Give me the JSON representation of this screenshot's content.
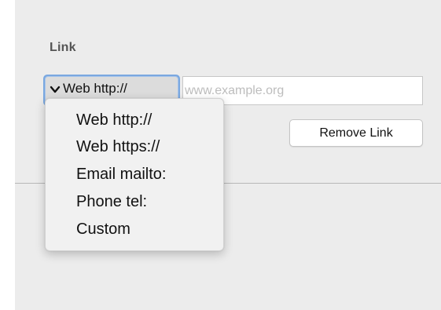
{
  "link_section": {
    "title": "Link",
    "protocol_selector": {
      "selected_value": "Web http://",
      "chevron_icon": "chevron-down-icon"
    },
    "url_input": {
      "value": "",
      "placeholder": "www.example.org"
    },
    "remove_link_label": "Remove Link",
    "protocol_options": [
      "Web http://",
      "Web https://",
      "Email mailto:",
      "Phone tel:",
      "Custom"
    ]
  },
  "colors": {
    "panel_background": "#ececec",
    "focus_ring": "#7aa8e0",
    "divider": "#b7b7b7"
  }
}
